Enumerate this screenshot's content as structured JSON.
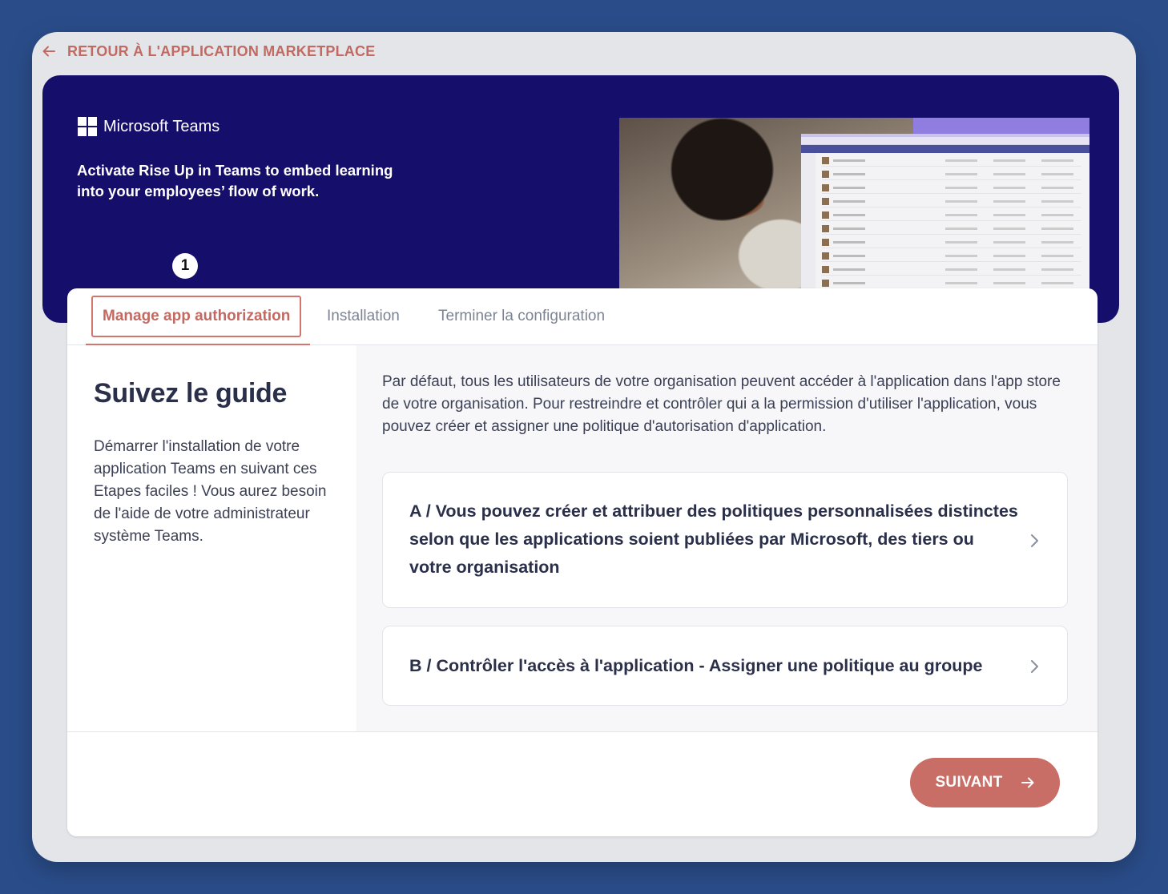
{
  "back_link": {
    "label": "RETOUR À L'APPLICATION MARKETPLACE"
  },
  "banner": {
    "brand": "Microsoft Teams",
    "tagline": "Activate Rise Up in Teams to embed learning into your employees’ flow of work.",
    "step_number": "1"
  },
  "tabs": [
    {
      "label": "Manage app authorization",
      "active": true
    },
    {
      "label": "Installation",
      "active": false
    },
    {
      "label": "Terminer la configuration",
      "active": false
    }
  ],
  "guide": {
    "title": "Suivez le guide",
    "description": "Démarrer l'installation de votre application Teams en suivant ces Etapes faciles ! Vous aurez besoin de l'aide de votre administrateur système Teams."
  },
  "content": {
    "intro": "Par défaut, tous les utilisateurs de votre organisation peuvent accéder à l'application dans l'app store de votre organisation. Pour restreindre et contrôler qui a la permission d'utiliser l'application, vous pouvez créer et assigner une politique d'autorisation d'application.",
    "items": [
      {
        "label": "A / Vous pouvez créer et attribuer des politiques personnalisées distinctes selon que les applications soient publiées par Microsoft, des tiers ou votre organisation"
      },
      {
        "label": "B / Contrôler l'accès à l'application - Assigner une politique au groupe"
      }
    ]
  },
  "footer": {
    "next_label": "SUIVANT"
  },
  "colors": {
    "accent": "#c86e66",
    "banner": "#160e6b",
    "background": "#2a4d8a"
  }
}
